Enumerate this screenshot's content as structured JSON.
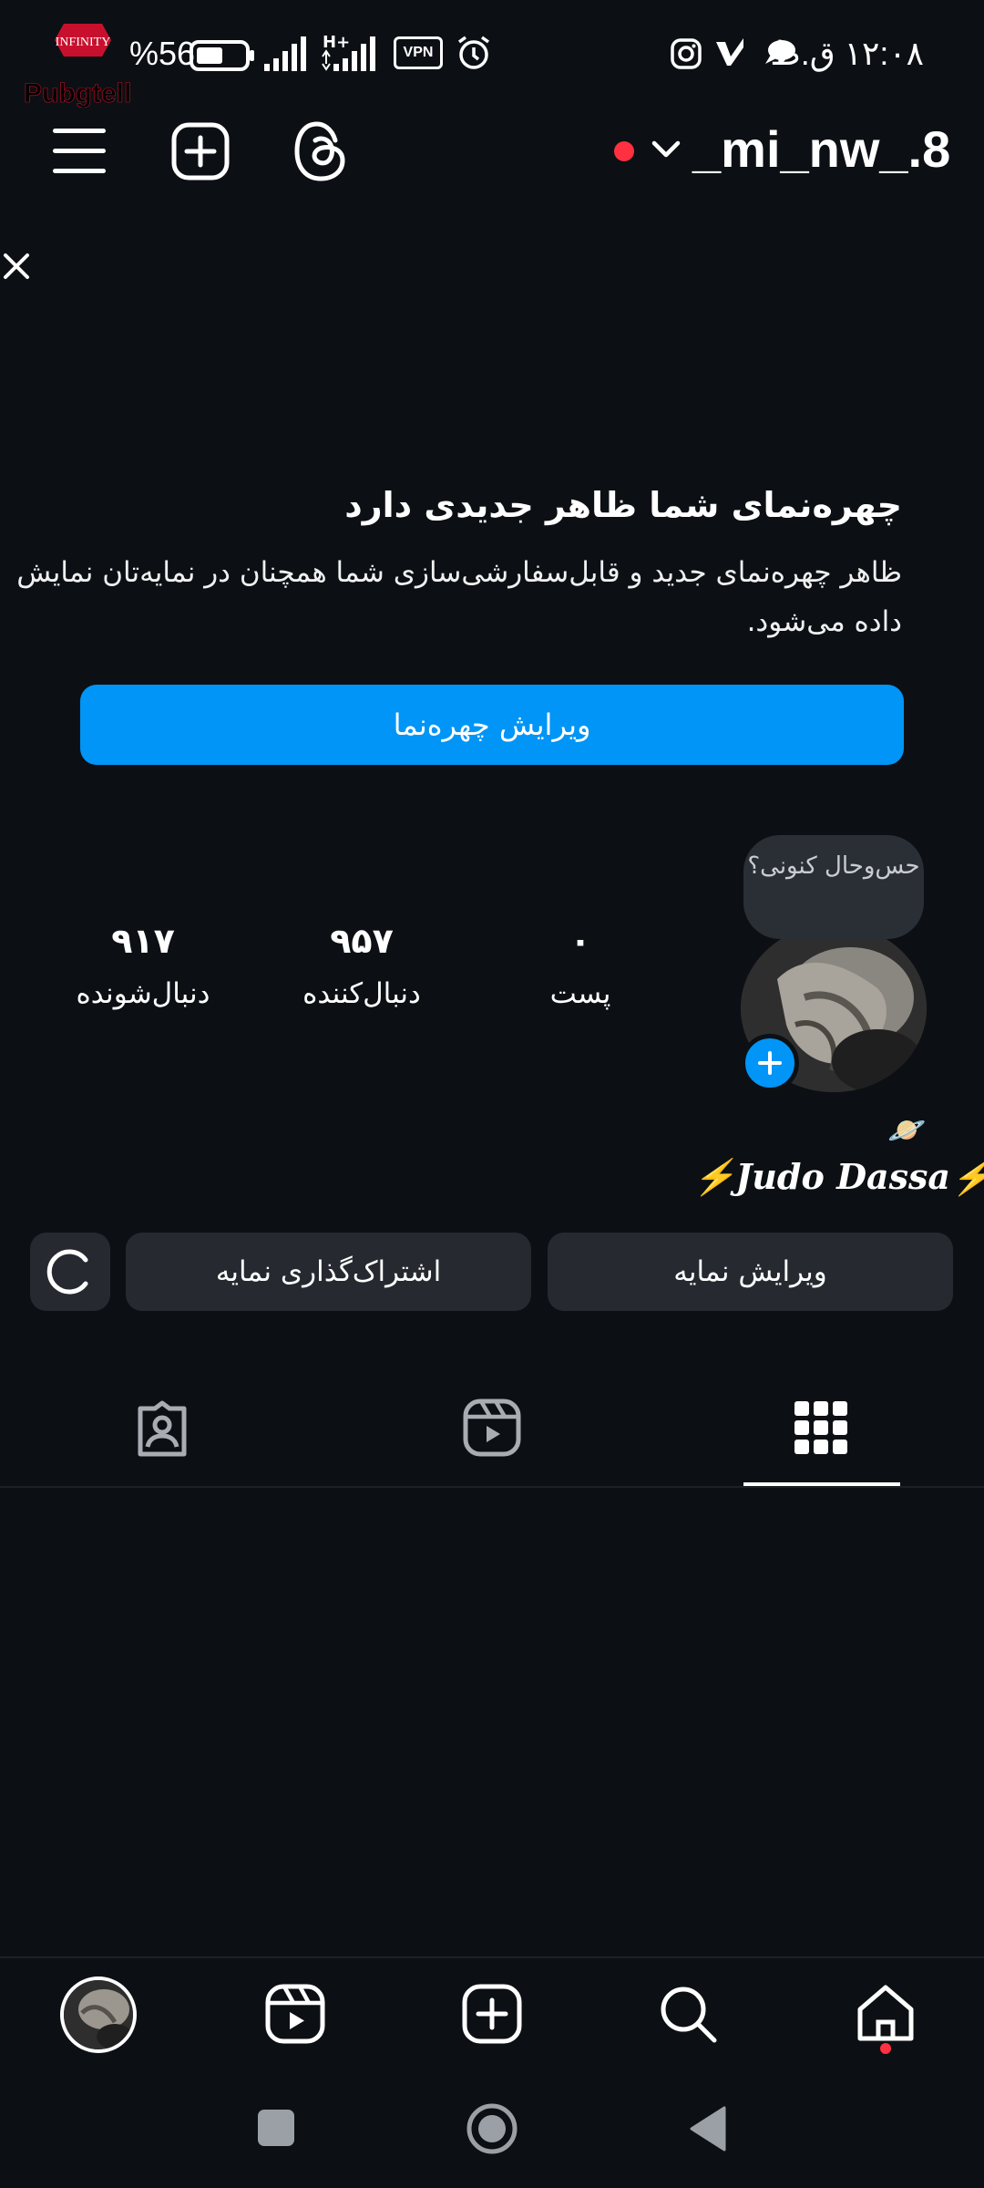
{
  "status_bar": {
    "battery_percent": "%56",
    "battery_level": 0.56,
    "network_type": "H+",
    "vpn_label": "VPN",
    "time": "۱۲:۰۸ ق.ظ",
    "watermark_brand": "INFINITY",
    "watermark_sub": "Pubgtell"
  },
  "header": {
    "username": "_mi_nw_.8",
    "account_switch_icon": "chevron-down-icon",
    "notification_dot_color": "#ff3040"
  },
  "promo": {
    "title": "چهره‌نمای شما ظاهر جدیدی دارد",
    "body": "ظاهر چهره‌نمای جدید و قابل‌سفارشی‌سازی شما همچنان در نمایه‌تان نمایش داده می‌شود.",
    "button_label": "ویرایش چهره‌نما"
  },
  "profile": {
    "note_text": "حس‌وحال کنونی؟",
    "stats": [
      {
        "value": "۰",
        "label": "پست"
      },
      {
        "value": "۹۵۷",
        "label": "دنبال‌کننده"
      },
      {
        "value": "۹۱۷",
        "label": "دنبال‌شونده"
      }
    ],
    "bio_emoji": "🪐",
    "bio_name": "⚡𝑱𝒖𝒅𝒐 𝑫𝒂𝒔𝒔𝒂⚡"
  },
  "actions": {
    "edit_profile": "ویرایش نمایه",
    "share_profile": "اشتراک‌گذاری نمایه"
  },
  "tabs": [
    "grid-icon",
    "reels-icon",
    "tagged-icon"
  ],
  "bottom_nav": [
    "home-icon",
    "search-icon",
    "create-icon",
    "reels-icon",
    "profile-avatar"
  ],
  "colors": {
    "background": "#0c1014",
    "accent": "#0095f6",
    "secondary_button": "#262a30"
  }
}
